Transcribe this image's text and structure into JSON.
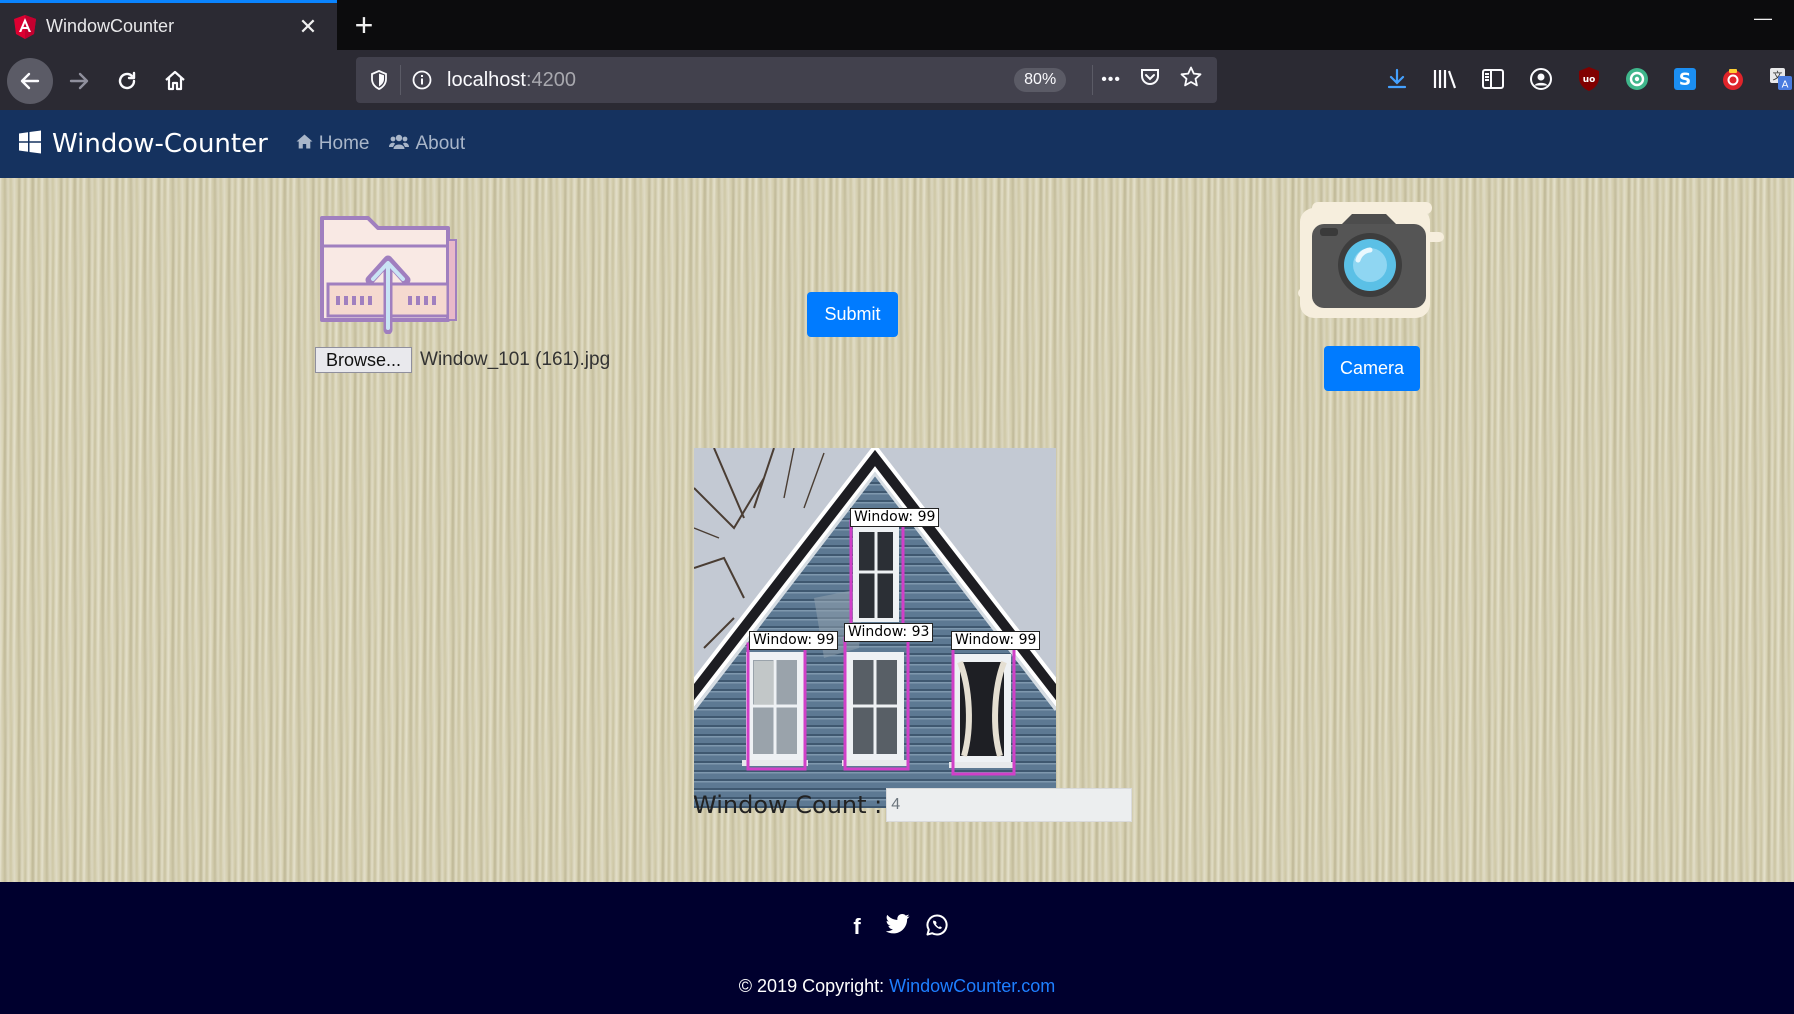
{
  "browser": {
    "tab_title": "WindowCounter",
    "tab_close": "✕",
    "new_tab": "+",
    "url_host": "localhost",
    "url_port": ":4200",
    "zoom": "80%",
    "page_actions_more": "•••",
    "minimize": "—"
  },
  "app": {
    "brand": "Window-Counter",
    "nav": [
      {
        "label": "Home",
        "icon": "home-icon"
      },
      {
        "label": "About",
        "icon": "users-icon"
      }
    ]
  },
  "upload": {
    "browse_label": "Browse...",
    "file_name": "Window_101 (161).jpg",
    "submit_label": "Submit"
  },
  "camera": {
    "button_label": "Camera"
  },
  "detections": [
    {
      "label": "Window: 99"
    },
    {
      "label": "Window: 99"
    },
    {
      "label": "Window: 93"
    },
    {
      "label": "Window: 99"
    }
  ],
  "result": {
    "count_label": "Window Count :",
    "count_value": "4"
  },
  "footer": {
    "social": [
      "facebook-icon",
      "twitter-icon",
      "whatsapp-icon"
    ],
    "facebook_glyph": "f",
    "twitter_glyph": "🐦",
    "whatsapp_glyph": "✆",
    "copyright_prefix": "© 2019 Copyright: ",
    "copyright_link": "WindowCounter.com"
  },
  "colors": {
    "primary_button": "#007bff",
    "app_navbar": "#15325f",
    "footer_bg": "#00002e",
    "detection_box": "#d040c8"
  }
}
